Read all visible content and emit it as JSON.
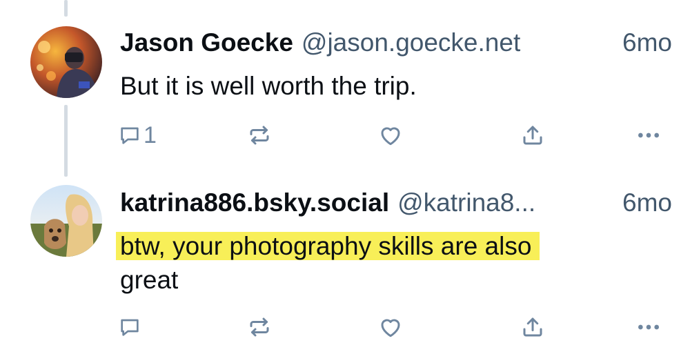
{
  "posts": [
    {
      "author_name": "Jason Goecke",
      "handle": "@jason.goecke.net",
      "time": "6mo",
      "text": "But it is well worth the trip.",
      "reply_count": "1",
      "avatar": "photographer-avatar"
    },
    {
      "author_name": "katrina886.bsky.social",
      "handle": "@katrina8...",
      "time": "6mo",
      "text_highlighted": "btw, your photography skills are also",
      "text_rest": "great",
      "reply_count": "",
      "avatar": "woman-with-dog-avatar",
      "highlight_color": "#f8ef58"
    }
  ],
  "icons": {
    "reply": "reply-icon",
    "repost": "repost-icon",
    "like": "heart-icon",
    "share": "share-icon",
    "more": "more-icon"
  },
  "colors": {
    "text": "#0b0f14",
    "secondary": "#42576c",
    "icon": "#6f869f",
    "thread_line": "#d4dbe2"
  }
}
